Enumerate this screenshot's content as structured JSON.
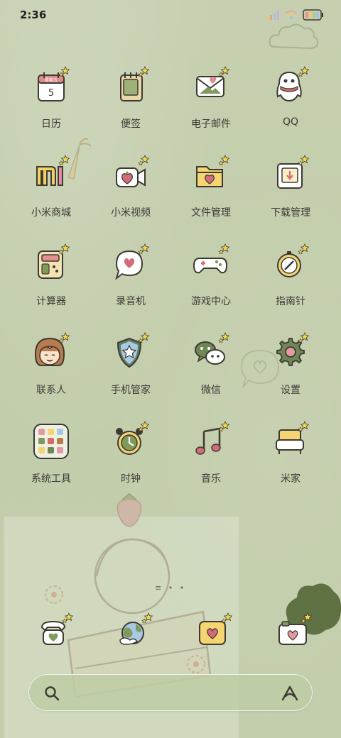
{
  "status_bar": {
    "time": "2:36"
  },
  "apps": [
    {
      "id": "calendar",
      "label": "日历",
      "icon": "calendar-icon",
      "calendar_weekday": "星期五",
      "calendar_day": "5"
    },
    {
      "id": "notes",
      "label": "便签",
      "icon": "notes-icon"
    },
    {
      "id": "email",
      "label": "电子邮件",
      "icon": "email-icon"
    },
    {
      "id": "qq",
      "label": "QQ",
      "icon": "qq-penguin-icon"
    },
    {
      "id": "mi-store",
      "label": "小米商城",
      "icon": "mi-store-icon"
    },
    {
      "id": "mi-video",
      "label": "小米视频",
      "icon": "video-camera-icon"
    },
    {
      "id": "file-manager",
      "label": "文件管理",
      "icon": "folder-icon"
    },
    {
      "id": "download-manager",
      "label": "下载管理",
      "icon": "download-icon"
    },
    {
      "id": "calculator",
      "label": "计算器",
      "icon": "calculator-icon"
    },
    {
      "id": "recorder",
      "label": "录音机",
      "icon": "speech-bubble-heart-icon"
    },
    {
      "id": "game-center",
      "label": "游戏中心",
      "icon": "gamepad-icon"
    },
    {
      "id": "compass",
      "label": "指南针",
      "icon": "compass-icon"
    },
    {
      "id": "contacts",
      "label": "联系人",
      "icon": "girl-face-icon"
    },
    {
      "id": "security",
      "label": "手机管家",
      "icon": "shield-star-icon"
    },
    {
      "id": "wechat",
      "label": "微信",
      "icon": "wechat-icon"
    },
    {
      "id": "settings",
      "label": "设置",
      "icon": "gear-icon"
    },
    {
      "id": "system-tools",
      "label": "系统工具",
      "icon": "folder-grid-icon"
    },
    {
      "id": "clock",
      "label": "时钟",
      "icon": "alarm-clock-icon"
    },
    {
      "id": "music",
      "label": "音乐",
      "icon": "music-note-icon"
    },
    {
      "id": "mi-home",
      "label": "米家",
      "icon": "armchair-icon"
    }
  ],
  "dock": [
    {
      "id": "phone",
      "icon": "telephone-icon"
    },
    {
      "id": "browser",
      "icon": "globe-icon"
    },
    {
      "id": "messages",
      "icon": "message-heart-icon"
    },
    {
      "id": "camera",
      "icon": "camera-icon"
    }
  ],
  "search": {
    "left_icon": "search-icon",
    "right_icon": "assistant-icon"
  },
  "colors": {
    "wallpaper": "#c4cfae",
    "accent_green": "#7f9a5a",
    "accent_pink": "#e59aa3",
    "outline": "#3d3a33",
    "star_yellow": "#f6d64a"
  }
}
